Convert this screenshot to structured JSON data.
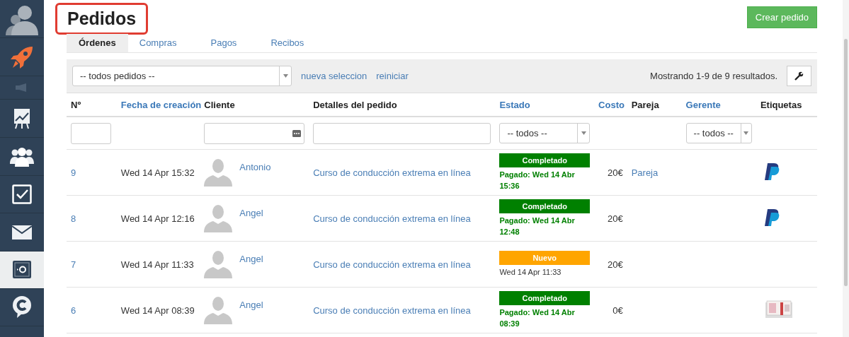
{
  "sidebar": {
    "items": [
      {
        "kind": "avatar",
        "selected": false
      },
      {
        "kind": "rocket",
        "selected": false
      },
      {
        "kind": "megaphone",
        "selected": false
      },
      {
        "kind": "chart",
        "selected": false
      },
      {
        "kind": "people",
        "selected": false
      },
      {
        "kind": "checkbox",
        "selected": false
      },
      {
        "kind": "mail",
        "selected": false
      },
      {
        "kind": "safe",
        "selected": true
      },
      {
        "kind": "chat",
        "selected": false
      }
    ]
  },
  "page": {
    "title": "Pedidos",
    "title_highlighted": true,
    "create_button": "Crear pedido"
  },
  "tabs": [
    {
      "label": "Órdenes",
      "selected": true
    },
    {
      "label": "Compras",
      "selected": false
    },
    {
      "label": "Pagos",
      "selected": false
    },
    {
      "label": "Recibos",
      "selected": false
    }
  ],
  "filter_bar": {
    "selection": "-- todos pedidos --",
    "links": [
      "nueva seleccion",
      "reiniciar"
    ],
    "summary": "Mostrando 1-9 de 9 resultados."
  },
  "table": {
    "columns": [
      {
        "label": "Nº",
        "sortable": false,
        "filter": {
          "kind": "text"
        }
      },
      {
        "label": "Fecha de creación",
        "sortable": true,
        "filter": {
          "kind": "none"
        }
      },
      {
        "label": "Cliente",
        "sortable": false,
        "filter": {
          "kind": "picker"
        }
      },
      {
        "label": "Detalles del pedido",
        "sortable": false,
        "filter": {
          "kind": "text"
        }
      },
      {
        "label": "Estado",
        "sortable": true,
        "filter": {
          "kind": "select",
          "value": "-- todos --"
        }
      },
      {
        "label": "Costo",
        "sortable": true,
        "filter": {
          "kind": "none"
        }
      },
      {
        "label": "Pareja",
        "sortable": false,
        "filter": {
          "kind": "none"
        }
      },
      {
        "label": "Gerente",
        "sortable": true,
        "filter": {
          "kind": "select",
          "value": "-- todos --"
        }
      },
      {
        "label": "Etiquetas",
        "sortable": false,
        "filter": {
          "kind": "none"
        }
      }
    ],
    "rows": [
      {
        "number": "9",
        "created": "Wed 14 Apr 15:32",
        "client": "Antonio",
        "details": "Curso de conducción extrema en línea",
        "status": {
          "kind": "completed",
          "label": "Completado",
          "note": "Pagado: Wed 14 Abr 15:36"
        },
        "cost": "20€",
        "partner": "Pareja",
        "tag": {
          "kind": "paypal"
        }
      },
      {
        "number": "8",
        "created": "Wed 14 Apr 12:16",
        "client": "Angel",
        "details": "Curso de conducción extrema en línea",
        "status": {
          "kind": "completed",
          "label": "Completado",
          "note": "Pagado: Wed 14 Abr 12:48"
        },
        "cost": "20€",
        "tag": {
          "kind": "paypal"
        }
      },
      {
        "number": "7",
        "created": "Wed 14 Apr 11:33",
        "client": "Angel",
        "details": "Curso de conducción extrema en línea",
        "status": {
          "kind": "new",
          "label": "Nuevo",
          "note": "Wed 14 Apr 11:33"
        },
        "cost": "20€"
      },
      {
        "number": "6",
        "created": "Wed 14 Apr 08:39",
        "client": "Angel",
        "details": "Curso de conducción extrema en línea",
        "status": {
          "kind": "completed",
          "label": "Completado",
          "note": "Pagado: Wed 14 Abr 08:39"
        },
        "cost": "0€",
        "tag": {
          "kind": "cash"
        }
      }
    ]
  }
}
